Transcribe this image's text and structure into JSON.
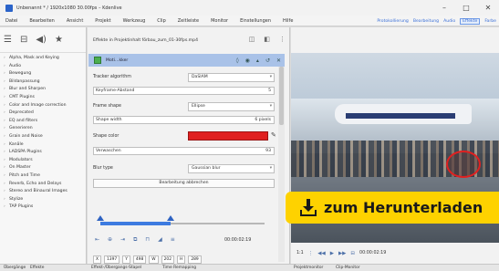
{
  "window": {
    "title": "Unbenannt * / 1920x1080 30.00fps – Kdenlive",
    "controls": [
      "–",
      "□",
      "✕"
    ]
  },
  "menu": {
    "items": [
      "Datei",
      "Bearbeiten",
      "Ansicht",
      "Projekt",
      "Werkzeug",
      "Clip",
      "Zeitleiste",
      "Monitor",
      "Einstellungen",
      "Hilfe"
    ],
    "layouts": [
      "Protokollierung",
      "Bearbeitung",
      "Audio",
      "Effekte",
      "Farbe"
    ],
    "active_layout": "Effekte"
  },
  "effects_panel": {
    "list": [
      "Alpha, Mask and Keying",
      "Audio",
      "Bewegung",
      "Bildanpassung",
      "Blur and Sharpen",
      "CMT Plugins",
      "Color and Image correction",
      "Deprecated",
      "EQ and filters",
      "Generieren",
      "Grain and Noise",
      "Kanäle",
      "LADSPA Plugins",
      "Modulators",
      "On Master",
      "Pitch and Time",
      "Reverb, Echo and Delays",
      "Stereo and Binaural Images",
      "Stylize",
      "TAP Plugins"
    ],
    "tabs": [
      "Übergänge",
      "Effekte"
    ]
  },
  "effect_stack": {
    "header": "Effekte in Projektinhalt förbau_zum_01-30fps.mp4",
    "effect_name": "Moti…kker",
    "params": {
      "tracker_algorithm_label": "Tracker algorithm",
      "tracker_algorithm_value": "DaSIAM",
      "keyframe_label": "Keyframe-Abstand",
      "keyframe_value": "5",
      "frame_shape_label": "Frame shape",
      "frame_shape_value": "Ellipse",
      "shape_width_label": "Shape width",
      "shape_width_value": "6 pixels",
      "shape_color_label": "Shape color",
      "blur_label": "Verwaschen",
      "blur_value": "93",
      "blur_type_label": "Blur type",
      "blur_type_value": "Gaussian blur",
      "cancel_button": "Bearbeitung abbrechen"
    },
    "timecode": "00:00:02:19",
    "progress": 0.43,
    "geometry": [
      "X",
      "1397",
      "Y",
      "498",
      "W",
      "202",
      "H",
      "289"
    ],
    "tabs": [
      "Effekt-/Übergangs-Stapel",
      "Time Remapping"
    ]
  },
  "monitor": {
    "zoom": "1:1",
    "timecode": "00:00:02:19",
    "tabs": [
      "Projektmonitor",
      "Clip-Monitor"
    ]
  },
  "banner": {
    "text": "zum Herunterladen"
  }
}
